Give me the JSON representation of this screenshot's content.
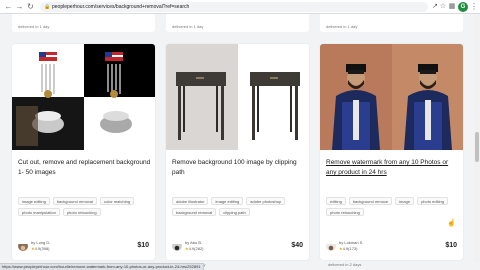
{
  "browser": {
    "url": "peopleperhour.com/services/background+removal?ref=search",
    "profile_initial": "G"
  },
  "previous_row": {
    "delivered_1": "delivered in 1 day",
    "delivered_2": "delivered in 1 day",
    "delivered_3": "delivered in 1 day"
  },
  "cards": [
    {
      "title": "Cut out, remove and replacement background 1- 50 images",
      "tags": [
        "image editing",
        "background removal",
        "color matching",
        "photo manipulation",
        "photo retouching"
      ],
      "seller_name": "Long D.",
      "rating": "4.9",
      "reviews": "(398)",
      "price": "$10"
    },
    {
      "title": "Remove background 100 image by clipping path",
      "tags": [
        "adobe illustrator",
        "image editing",
        "adobe photoshop",
        "background removal",
        "clipping path"
      ],
      "seller_name": "Abu B.",
      "rating": "4.9",
      "reviews": "(282)",
      "price": "$40"
    },
    {
      "title": "Remove watermark from any 10 Photos or any product in 24 hrs",
      "tags": [
        "editing",
        "background remove",
        "image",
        "photo editing",
        "photo retouching"
      ],
      "seller_name": "Lokman S.",
      "rating": "4.9",
      "reviews": "(173)",
      "price": "$10"
    }
  ],
  "status_bar": "https://www.peopleperhour.com/hourlie/remove-watermark-from-any-10-photos-or-any-product-in-24-hrs/252891",
  "bottom_row": {
    "delivered_2": "delivered in 1 day",
    "delivered_3": "delivered in 2 days"
  }
}
